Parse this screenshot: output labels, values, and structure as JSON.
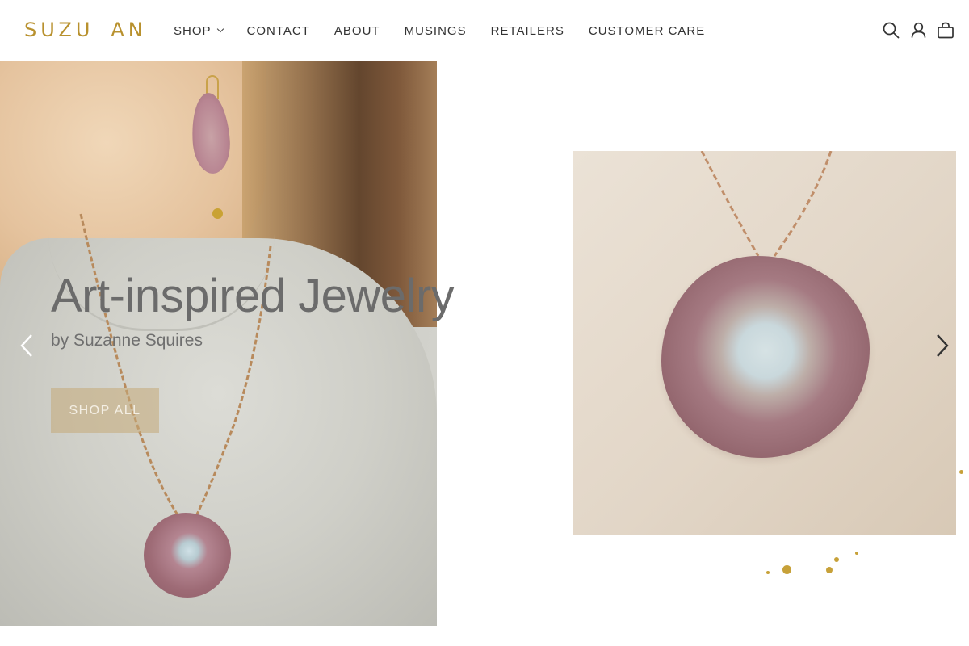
{
  "brand": {
    "logo_left": "SUZU",
    "logo_right": "AN"
  },
  "nav": {
    "items": [
      {
        "label": "SHOP",
        "has_dropdown": true
      },
      {
        "label": "CONTACT",
        "has_dropdown": false
      },
      {
        "label": "ABOUT",
        "has_dropdown": false
      },
      {
        "label": "MUSINGS",
        "has_dropdown": false
      },
      {
        "label": "RETAILERS",
        "has_dropdown": false
      },
      {
        "label": "CUSTOMER CARE",
        "has_dropdown": false
      }
    ]
  },
  "header_icons": [
    "search-icon",
    "account-icon",
    "cart-icon"
  ],
  "hero": {
    "title": "Art-inspired Jewelry",
    "subtitle": "by Suzanne Squires",
    "cta_label": "SHOP ALL",
    "prev_icon": "chevron-left-icon",
    "next_icon": "chevron-right-icon"
  },
  "colors": {
    "brand_gold": "#b8912e",
    "nav_text": "#333333",
    "hero_text": "#6b6b6b",
    "cta_bg": "#c4aa78"
  }
}
